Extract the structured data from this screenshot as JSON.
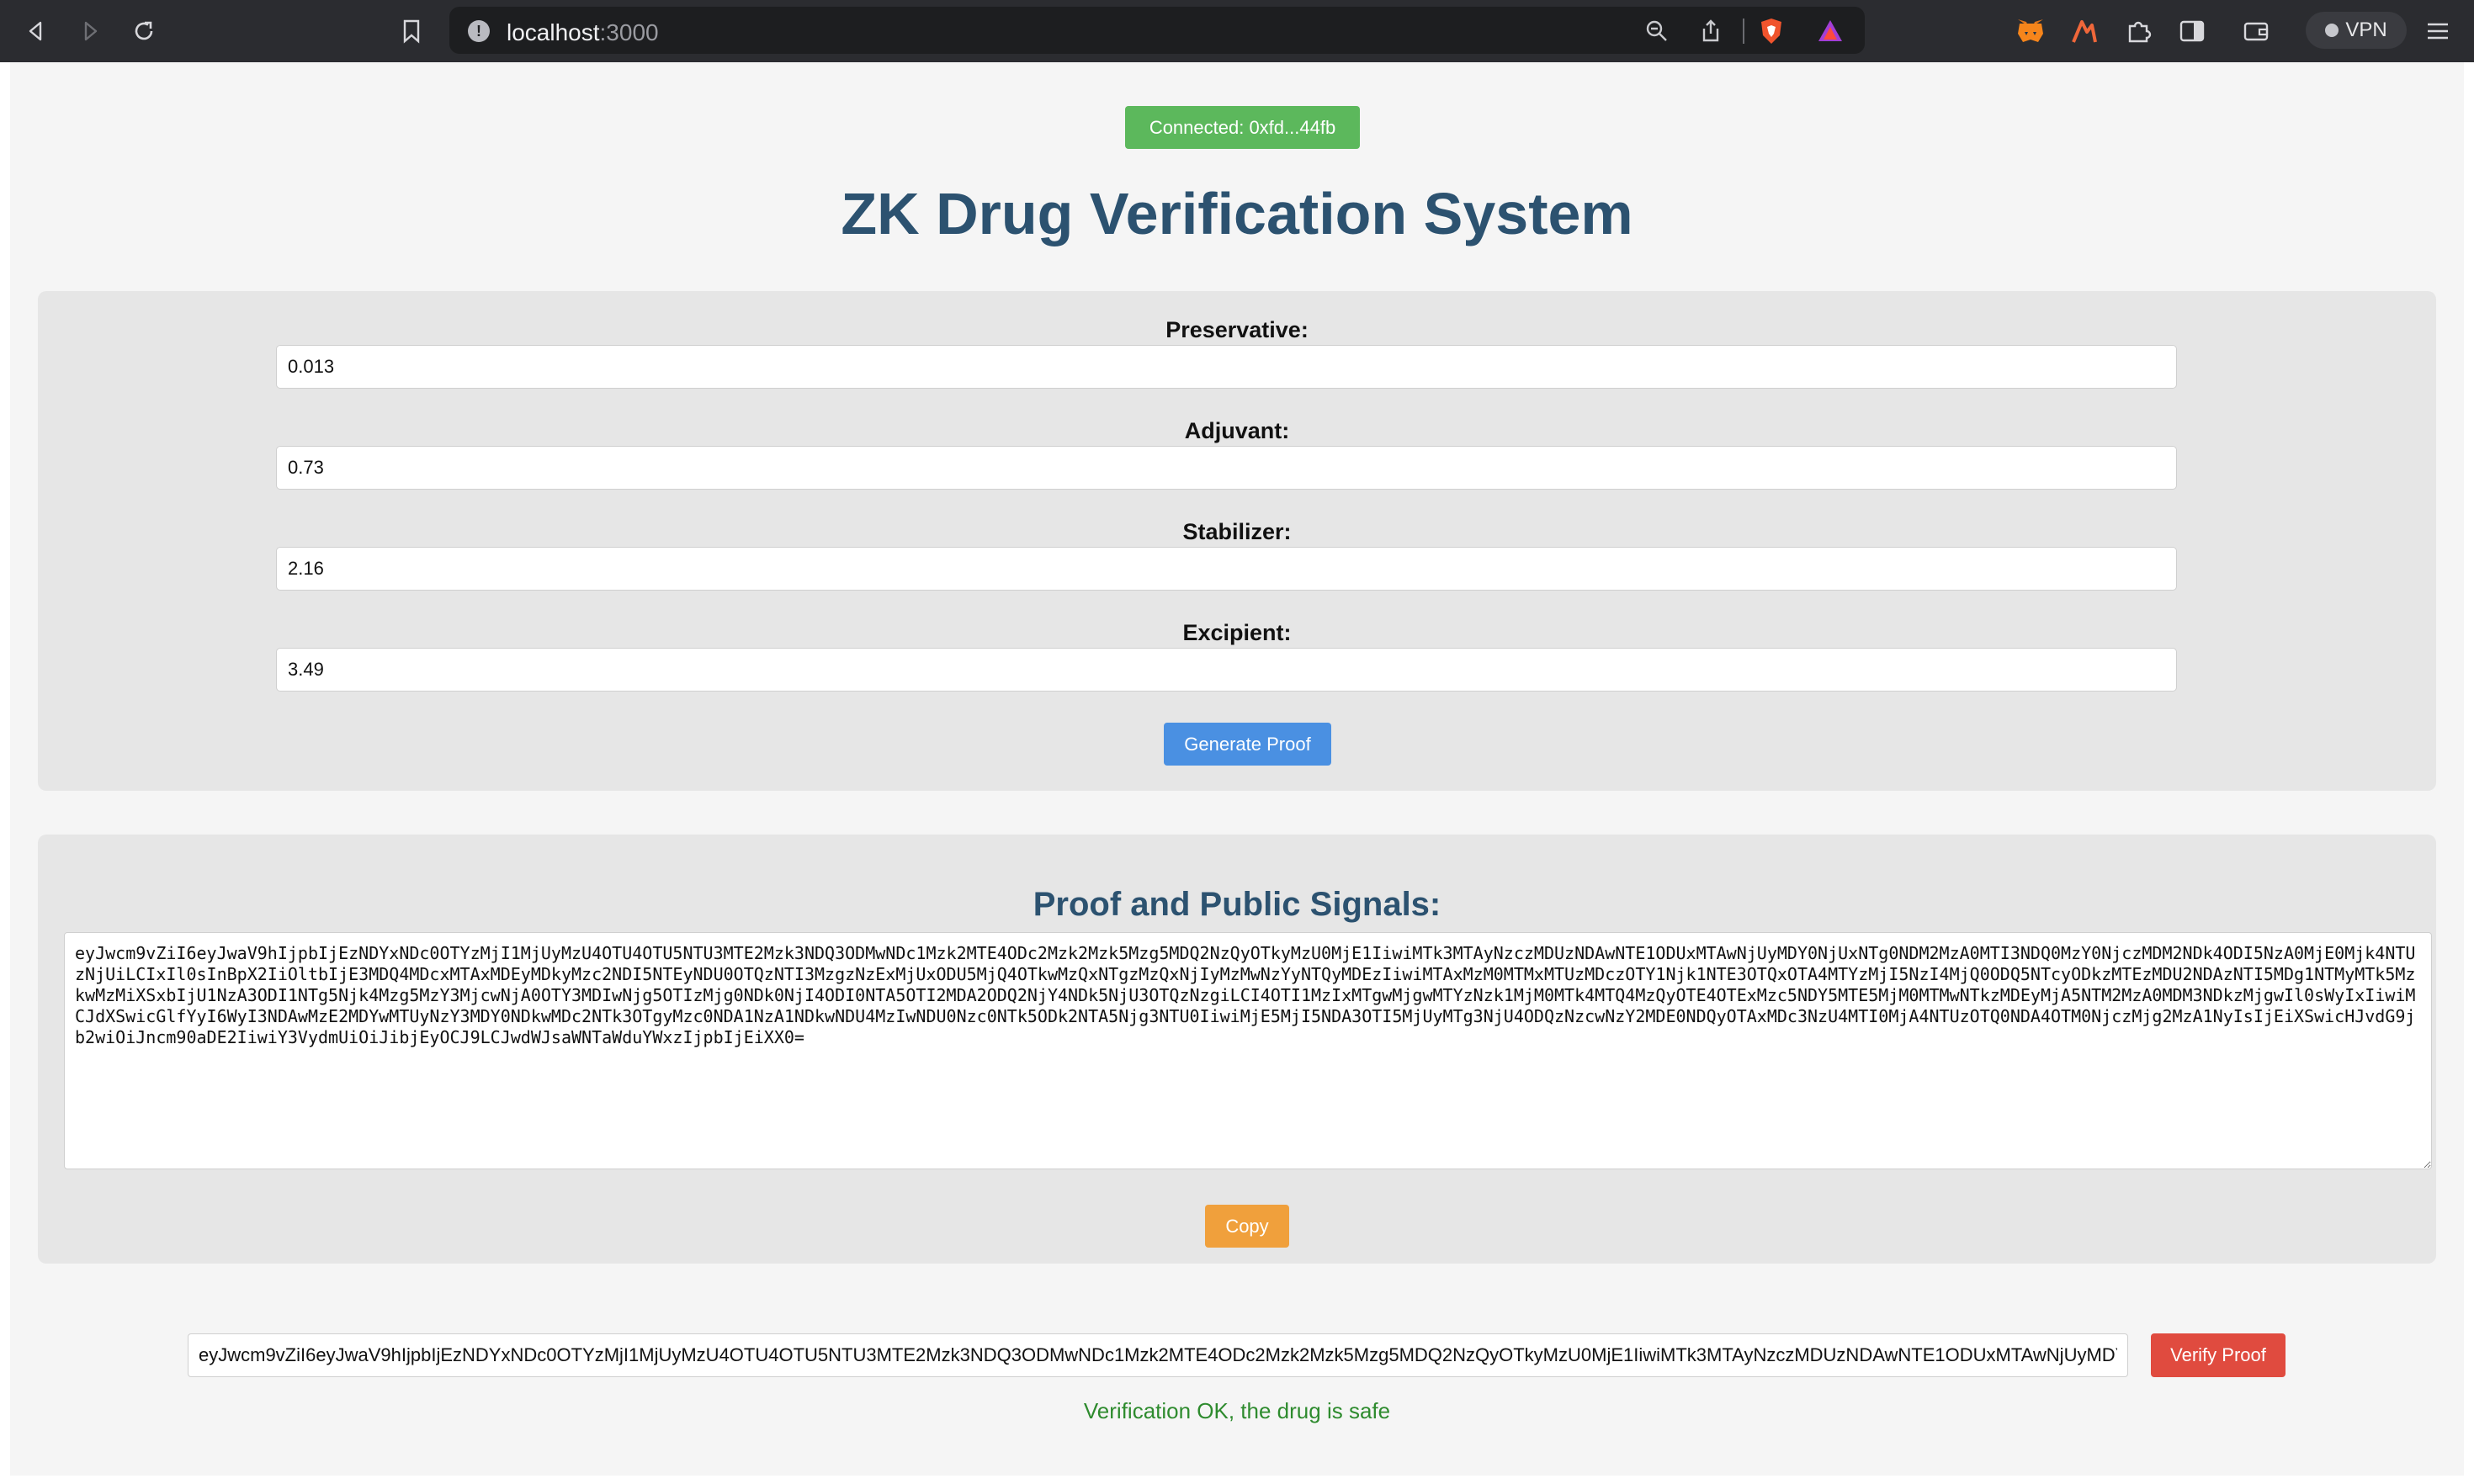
{
  "browser": {
    "url_host": "localhost",
    "url_port": ":3000",
    "vpn_label": "VPN",
    "icons": [
      "back-icon",
      "forward-icon",
      "reload-icon",
      "bookmark-icon",
      "site-info-icon",
      "zoom-icon",
      "share-icon",
      "brave-shields-icon",
      "brave-rewards-icon",
      "metamask-icon",
      "extension-icon",
      "extensions-puzzle-icon",
      "sidebar-icon",
      "wallet-icon",
      "menu-icon"
    ]
  },
  "status": {
    "connected_label": "Connected: 0xfd...44fb"
  },
  "header": {
    "title": "ZK Drug Verification System"
  },
  "form": {
    "fields": [
      {
        "label": "Preservative:",
        "value": "0.013"
      },
      {
        "label": "Adjuvant:",
        "value": "0.73"
      },
      {
        "label": "Stabilizer:",
        "value": "2.16"
      },
      {
        "label": "Excipient:",
        "value": "3.49"
      }
    ],
    "generate_label": "Generate Proof"
  },
  "proof": {
    "title": "Proof and Public Signals:",
    "text": "eyJwcm9vZiI6eyJwaV9hIjpbIjEzNDYxNDc0OTYzMjI1MjUyMzU4OTU4OTU5NTU3MTE2Mzk3NDQ3ODMwNDc1Mzk2MTE4ODc2Mzk2Mzk5Mzg5MDQ2NzQyOTkyMzU0MjE1IiwiMTk3MTAyNzczMDUzNDAwNTE1ODUxMTAwNjUyMDY0NjUxNTg0NDM2MzA0MTI3NDQ0MzY0NjczMDM2NDk4ODI5NzA0MjE0Mjk4NTUzNjUiLCIxIl0sInBpX2IiOltbIjE3MDQ4MDcxMTAxMDEyMDkyMzc2NDI5NTEyNDU0OTQzNTI3MzgzNzExMjUxODU5MjQ4OTkwMzQxNTgzMzQxNjIyMzMwNzYyNTQyMDEzIiwiMTAxMzM0MTMxMTUzMDczOTY1Njk1NTE3OTQxOTA4MTYzMjI5NzI4MjQ0ODQ5NTcyODkzMTEzMDU2NDAzNTI5MDg1NTMyMTk5MzkwMzMiXSxbIjU1NzA3ODI1NTg5Njk4Mzg5MzY3MjcwNjA0OTY3MDIwNjg5OTIzMjg0NDk0NjI4ODI0NTA5OTI2MDA2ODQ2NjY4NDk5NjU3OTQzNzgiLCI4OTI1MzIxMTgwMjgwMTYzNzk1MjM0MTk4MTQ4MzQyOTE4OTExMzc5NDY5MTE5MjM0MTMwNTkzMDEyMjA5NTM2MzA0MDM3NDkzMjgwIl0sWyIxIiwiMCJdXSwicGlfYyI6WyI3NDAwMzE2MDYwMTUyNzY3MDY0NDkwMDc2NTk3OTgyMzc0NDA1NzA1NDkwNDU4MzIwNDU0Nzc0NTk5ODk2NTA5Njg3NTU0IiwiMjE5MjI5NDA3OTI5MjUyMTg3NjU4ODQzNzcwNzY2MDE0NDQyOTAxMDc3NzU4MTI0MjA4NTUzOTQ0NDA4OTM0NjczMjg2MzA1NyIsIjEiXSwicHJvdG9jb2wiOiJncm90aDE2IiwiY3VydmUiOiJibjEyOCJ9LCJwdWJsaWNTaWduYWxzIjpbIjEiXX0="
  },
  "verify": {
    "input_value": "eyJwcm9vZiI6eyJwaV9hIjpbIjEzNDYxNDc0OTYzMjI1MjUyMzU4OTU4OTU5NTU3MTE2Mzk3NDQ3ODMwNDc1Mzk2MTE4ODc2Mzk2Mzk5Mzg5MDQ2NzQyOTkyMzU0MjE1IiwiMTk3MTAyNzczMDUzNDAwNTE1ODUxMTAwNjUyMDY0NjUx",
    "button_label": "Verify Proof",
    "result": "Verification OK, the drug is safe"
  }
}
